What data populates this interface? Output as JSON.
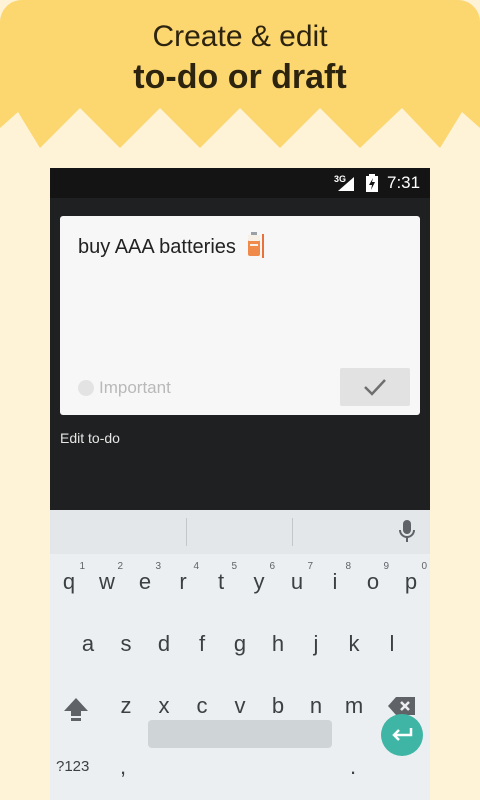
{
  "banner": {
    "line1": "Create & edit",
    "line2": "to-do or draft",
    "color": "#fcd66f"
  },
  "statusbar": {
    "network": "3G",
    "time": "7:31"
  },
  "editor": {
    "text": "buy AAA batteries",
    "important_label": "Important",
    "caption": "Edit to-do"
  },
  "keyboard": {
    "row1": [
      {
        "key": "q",
        "hint": "1"
      },
      {
        "key": "w",
        "hint": "2"
      },
      {
        "key": "e",
        "hint": "3"
      },
      {
        "key": "r",
        "hint": "4"
      },
      {
        "key": "t",
        "hint": "5"
      },
      {
        "key": "y",
        "hint": "6"
      },
      {
        "key": "u",
        "hint": "7"
      },
      {
        "key": "i",
        "hint": "8"
      },
      {
        "key": "o",
        "hint": "9"
      },
      {
        "key": "p",
        "hint": "0"
      }
    ],
    "row2": [
      "a",
      "s",
      "d",
      "f",
      "g",
      "h",
      "j",
      "k",
      "l"
    ],
    "row3": [
      "z",
      "x",
      "c",
      "v",
      "b",
      "n",
      "m"
    ],
    "symbols_label": "?123",
    "comma": ",",
    "period": ".",
    "enter_color": "#3fb5a5"
  }
}
